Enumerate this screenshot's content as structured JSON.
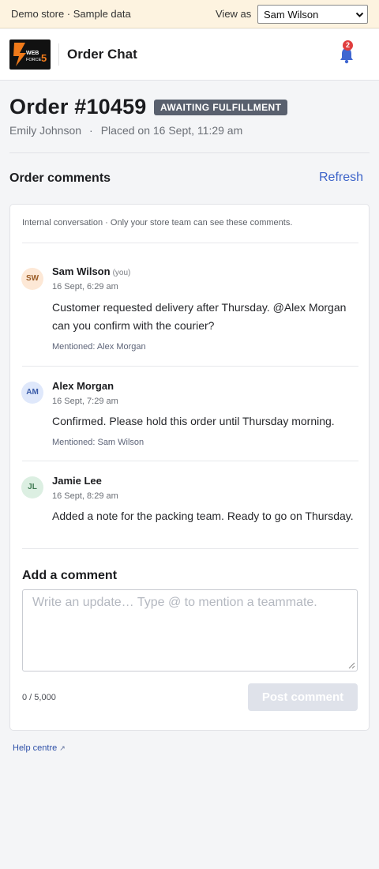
{
  "demo_bar": {
    "text": "Demo store · Sample data",
    "view_as_label": "View as",
    "view_as_selected": "Sam Wilson"
  },
  "header": {
    "logo_text": "WEB FORCE 5",
    "title": "Order Chat",
    "notification_count": "2"
  },
  "order": {
    "title": "Order #10459",
    "status": "AWAITING FULFILLMENT",
    "customer": "Emily Johnson",
    "separator": "·",
    "placed": "Placed on 16 Sept, 11:29 am",
    "status_color": "#59606e"
  },
  "comments_section": {
    "title": "Order comments",
    "refresh_label": "Refresh",
    "note": "Internal conversation · Only your store team can see these comments."
  },
  "comments": [
    {
      "initials": "SW",
      "author": "Sam Wilson",
      "you_label": "(you)",
      "time": "16 Sept, 6:29 am",
      "body": "Customer requested delivery after Thursday. @Alex Morgan can you confirm with the courier?",
      "mention": "Mentioned: Alex Morgan",
      "avatar_bg": "#fde8d6",
      "avatar_fg": "#9a5a23"
    },
    {
      "initials": "AM",
      "author": "Alex Morgan",
      "time": "16 Sept, 7:29 am",
      "body": "Confirmed. Please hold this order until Thursday morning.",
      "mention": "Mentioned: Sam Wilson",
      "avatar_bg": "#dfe8fb",
      "avatar_fg": "#3a5ba8"
    },
    {
      "initials": "JL",
      "author": "Jamie Lee",
      "time": "16 Sept, 8:29 am",
      "body": "Added a note for the packing team. Ready to go on Thursday.",
      "avatar_bg": "#dcefe2",
      "avatar_fg": "#3f7a52"
    }
  ],
  "composer": {
    "title": "Add a comment",
    "placeholder": "Write an update… Type @ to mention a teammate.",
    "char_count": "0 / 5,000",
    "post_label": "Post comment"
  },
  "footer": {
    "help_label": "Help centre",
    "help_arrow": "↗"
  }
}
